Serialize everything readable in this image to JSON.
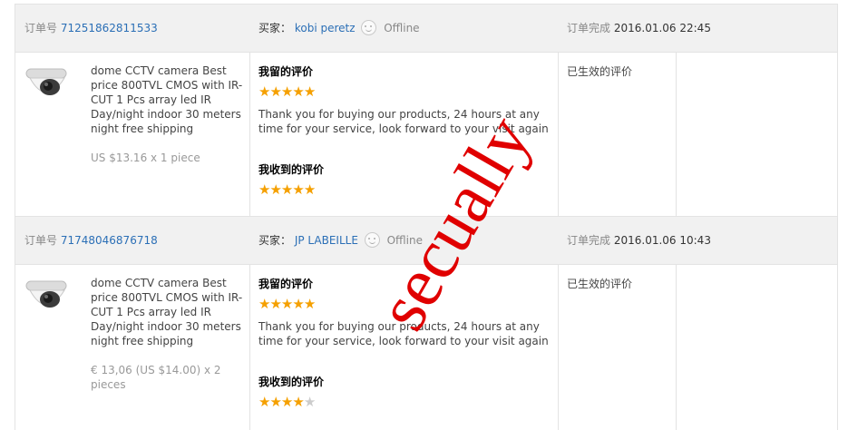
{
  "orders": [
    {
      "order_label": "订单号",
      "order_no": "71251862811533",
      "buyer_label": "买家：",
      "buyer_name": "kobi peretz",
      "buyer_status": "Offline",
      "status_label": "订单完成",
      "completed_at": "2016.01.06 22:45",
      "product_title": "dome CCTV camera Best price 800TVL CMOS with IR-CUT 1 Pcs array led IR Day/night indoor 30 meters night free shipping",
      "price": "US $13.16 x 1 piece",
      "my_review_title": "我留的评价",
      "my_rating": 5,
      "my_review_text": "Thank you for buying our products, 24 hours at any time for your service, look forward to your visit again",
      "received_review_title": "我收到的评价",
      "received_rating": 5,
      "review_status": "已生效的评价"
    },
    {
      "order_label": "订单号",
      "order_no": "71748046876718",
      "buyer_label": "买家：",
      "buyer_name": "JP LABEILLE",
      "buyer_status": "Offline",
      "status_label": "订单完成",
      "completed_at": "2016.01.06 10:43",
      "product_title": "dome CCTV camera Best price 800TVL CMOS with IR-CUT 1 Pcs array led IR Day/night indoor 30 meters night free shipping",
      "price": "€ 13,06 (US $14.00) x 2 pieces",
      "my_review_title": "我留的评价",
      "my_rating": 5,
      "my_review_text": "Thank you for buying our products, 24 hours at any time for your service, look forward to your visit again",
      "received_review_title": "我收到的评价",
      "received_rating": 4,
      "review_status": "已生效的评价"
    }
  ],
  "max_rating": 5,
  "watermark_text": "secually",
  "colors": {
    "link": "#2b6fb6",
    "star": "#f5a000",
    "watermark": "#e00000"
  },
  "icons": {
    "buyer_status": "smiley-face-icon",
    "product": "dome-camera-icon",
    "rating": "star-icon"
  }
}
